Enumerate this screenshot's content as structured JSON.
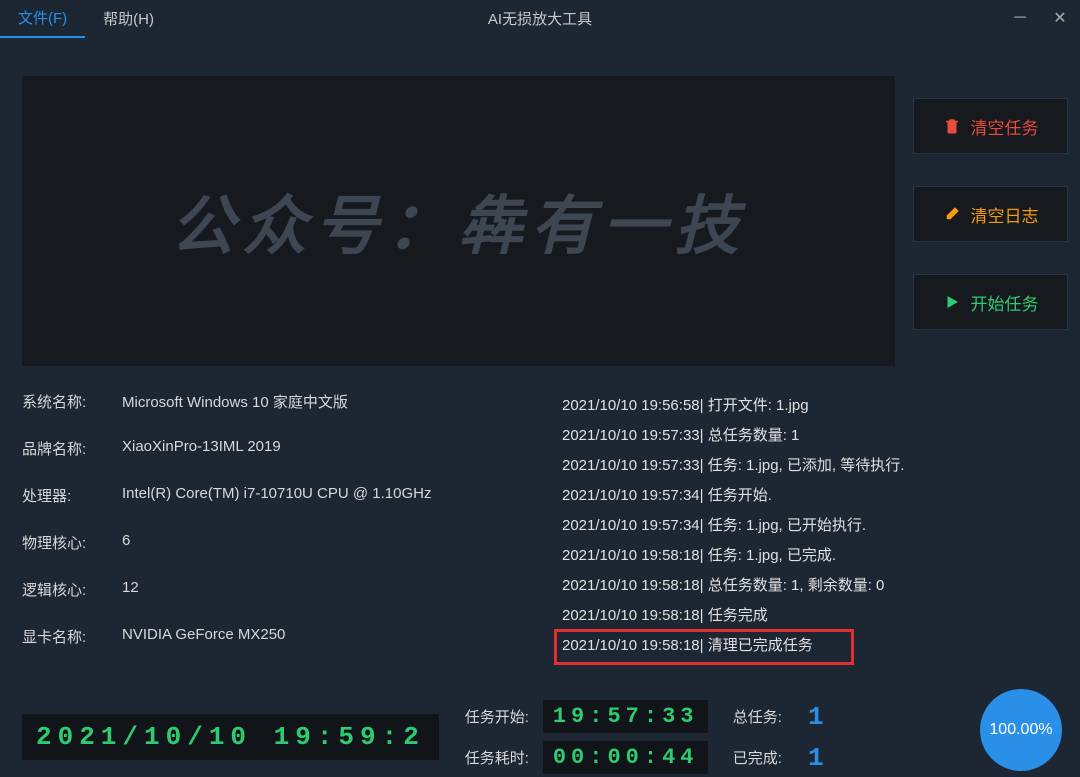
{
  "menubar": {
    "file": "文件(F)",
    "help": "帮助(H)",
    "title": "AI无损放大工具"
  },
  "preview": {
    "text": "公众号：犇有一技"
  },
  "buttons": {
    "clear_tasks": "清空任务",
    "clear_logs": "清空日志",
    "start_tasks": "开始任务"
  },
  "sysinfo": {
    "os_label": "系统名称:",
    "os_value": "Microsoft Windows 10 家庭中文版",
    "brand_label": "品牌名称:",
    "brand_value": "XiaoXinPro-13IML 2019",
    "cpu_label": "处理器:",
    "cpu_value": "Intel(R) Core(TM) i7-10710U CPU @ 1.10GHz",
    "phys_label": "物理核心:",
    "phys_value": "6",
    "logic_label": "逻辑核心:",
    "logic_value": "12",
    "gpu_label": "显卡名称:",
    "gpu_value": "NVIDIA GeForce MX250"
  },
  "logs": [
    "2021/10/10 19:56:58| 打开文件: 1.jpg",
    "2021/10/10 19:57:33| 总任务数量: 1",
    "2021/10/10 19:57:33| 任务: 1.jpg, 已添加, 等待执行.",
    "2021/10/10 19:57:34| 任务开始.",
    "2021/10/10 19:57:34| 任务: 1.jpg, 已开始执行.",
    "2021/10/10 19:58:18| 任务: 1.jpg, 已完成.",
    "2021/10/10 19:58:18| 总任务数量: 1, 剩余数量: 0",
    "2021/10/10 19:58:18| 任务完成",
    "2021/10/10 19:58:18| 清理已完成任务"
  ],
  "footer": {
    "datetime": "2021/10/10 19:59:2",
    "start_label": "任务开始:",
    "start_time": "19:57:33",
    "elapsed_label": "任务耗时:",
    "elapsed_time": "00:00:44",
    "total_label": "总任务:",
    "total_value": "1",
    "done_label": "已完成:",
    "done_value": "1",
    "progress": "100.00%"
  }
}
